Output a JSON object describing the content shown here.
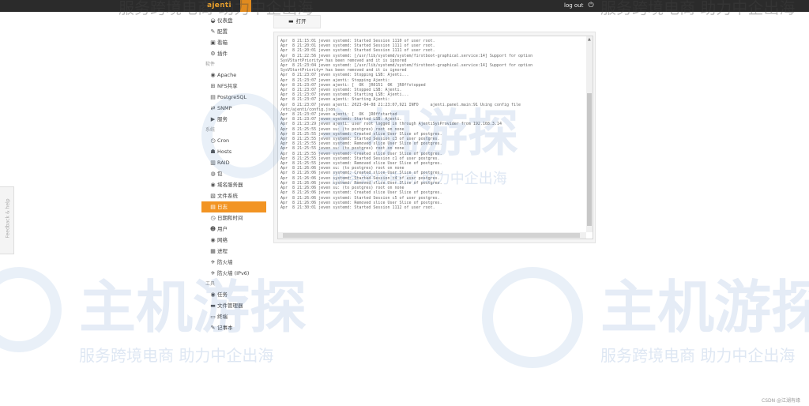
{
  "header": {
    "brand": "ajenti",
    "logout_label": "log out",
    "power_icon": "⏻"
  },
  "sidebar": {
    "top_items": [
      {
        "icon": "dashboard-icon",
        "glyph": "◒",
        "label": "仪表盘"
      },
      {
        "icon": "wrench-icon",
        "glyph": "✎",
        "label": "配置"
      },
      {
        "icon": "package-icon",
        "glyph": "▣",
        "label": "看箱"
      },
      {
        "icon": "plugins-icon",
        "glyph": "⚙",
        "label": "插件"
      }
    ],
    "section_software": "软件",
    "software_items": [
      {
        "icon": "apache-icon",
        "glyph": "◉",
        "label": "Apache"
      },
      {
        "icon": "nfs-icon",
        "glyph": "⊞",
        "label": "NFS共享"
      },
      {
        "icon": "database-icon",
        "glyph": "▤",
        "label": "PostgreSQL"
      },
      {
        "icon": "snmp-icon",
        "glyph": "⇄",
        "label": "SNMP"
      },
      {
        "icon": "services-icon",
        "glyph": "▶",
        "label": "服务"
      }
    ],
    "section_system": "系统",
    "system_items": [
      {
        "icon": "cron-icon",
        "glyph": "◷",
        "label": "Cron"
      },
      {
        "icon": "hosts-icon",
        "glyph": "☗",
        "label": "Hosts"
      },
      {
        "icon": "raid-icon",
        "glyph": "▥",
        "label": "RAID"
      },
      {
        "icon": "users-lock-icon",
        "glyph": "◍",
        "label": "包"
      },
      {
        "icon": "domain-icon",
        "glyph": "◉",
        "label": "域名服务器"
      },
      {
        "icon": "filesystem-icon",
        "glyph": "▧",
        "label": "文件系统"
      },
      {
        "icon": "log-icon",
        "glyph": "▤",
        "label": "日志"
      },
      {
        "icon": "clock-icon",
        "glyph": "◷",
        "label": "日期和时间"
      },
      {
        "icon": "user-group-icon",
        "glyph": "☻",
        "label": "用户"
      },
      {
        "icon": "network-icon",
        "glyph": "◉",
        "label": "网络"
      },
      {
        "icon": "process-icon",
        "glyph": "▦",
        "label": "进程"
      },
      {
        "icon": "firewall-icon",
        "glyph": "✈",
        "label": "防火墙"
      },
      {
        "icon": "firewall-ipv6-icon",
        "glyph": "✈",
        "label": "防火墙 (IPv6)"
      }
    ],
    "section_tools": "工具",
    "tool_items": [
      {
        "icon": "tasks-icon",
        "glyph": "◉",
        "label": "任务"
      },
      {
        "icon": "file-manager-icon",
        "glyph": "▬",
        "label": "文件管理器"
      },
      {
        "icon": "terminal-icon",
        "glyph": "▭",
        "label": "终端"
      },
      {
        "icon": "notepad-icon",
        "glyph": "✎",
        "label": "记事本"
      }
    ],
    "active_label": "日志"
  },
  "toolbar": {
    "open_label": "打开",
    "open_icon": "▬"
  },
  "log": {
    "lines": [
      "Apr  8 21:15:01 jeven systemd: Started Session 1110 of user root.",
      "Apr  8 21:20:01 jeven systemd: Started Session 1111 of user root.",
      "Apr  8 21:20:01 jeven systemd: Started Session 1111 of user root.",
      "Apr  8 21:22:56 jeven systemd: [/usr/lib/systemd/system/firstboot-graphical.service:14] Support for option",
      "SysVStartPriority= has been removed and it is ignored",
      "Apr  8 21:23:04 jeven systemd: [/usr/lib/systemd/system/firstboot-graphical.service:14] Support for option",
      "SysVStartPriority= has been removed and it is ignored",
      "Apr  8 21:23:07 jeven systemd: Stopping LSB: Ajenti...",
      "Apr  8 21:23:07 jeven ajenti: Stopping Ajenti:",
      "Apr  8 21:23:07 jeven ajenti: [  OK  ]R0151  OK  ]R0ffstopped",
      "Apr  8 21:23:07 jeven systemd: Stopped LSB: Ajenti.",
      "Apr  8 21:23:07 jeven systemd: Starting LSB: Ajenti...",
      "Apr  8 21:23:07 jeven ajenti: Starting Ajenti:",
      "Apr  8 21:23:07 jeven ajenti: 2023-04-08 21:23:07,921 INFO     ajenti.panel.main:91 Using config file",
      "/etc/ajenti/config.json",
      "Apr  8 21:23:07 jeven ajenti: [  OK  ]R0ffstarted",
      "Apr  8 21:23:07 jeven systemd: Started LSB: Ajenti.",
      "Apr  8 21:23:29 jeven ajenti: user root logged in through AjentiSysProvider from 192.168.3.14",
      "Apr  8 21:25:55 jeven su: (to postgres) root on none",
      "Apr  8 21:25:55 jeven systemd: Created slice User Slice of postgres.",
      "Apr  8 21:25:55 jeven systemd: Started Session c3 of user postgres.",
      "Apr  8 21:25:55 jeven systemd: Removed slice User Slice of postgres.",
      "Apr  8 21:25:55 jeven su: (to postgres) root on none",
      "Apr  8 21:25:55 jeven systemd: Created slice User Slice of postgres.",
      "Apr  8 21:25:55 jeven systemd: Started Session c1 of user postgres.",
      "Apr  8 21:25:55 jeven systemd: Removed slice User Slice of postgres.",
      "Apr  8 21:26:06 jeven su: (to postgres) root on none",
      "Apr  8 21:26:06 jeven systemd: Created slice User Slice of postgres.",
      "Apr  8 21:26:06 jeven systemd: Started Session c4 of user postgres.",
      "Apr  8 21:26:06 jeven systemd: Removed slice User Slice of postgres.",
      "Apr  8 21:26:06 jeven su: (to postgres) root on none",
      "Apr  8 21:26:06 jeven systemd: Created slice User Slice of postgres.",
      "Apr  8 21:26:06 jeven systemd: Started Session c5 of user postgres.",
      "Apr  8 21:26:06 jeven systemd: Removed slice User Slice of postgres.",
      "Apr  8 21:30:01 jeven systemd: Started Session 1112 of user root."
    ]
  },
  "feedback": {
    "label": "Feedback & help"
  },
  "watermark": {
    "brand_text": "主机游探",
    "slogan": "服务跨境电商 助力中企出海"
  },
  "credit": "CSDN @江湖有缘",
  "colors": {
    "accent": "#f29423",
    "topbar": "#2b2b2b"
  }
}
